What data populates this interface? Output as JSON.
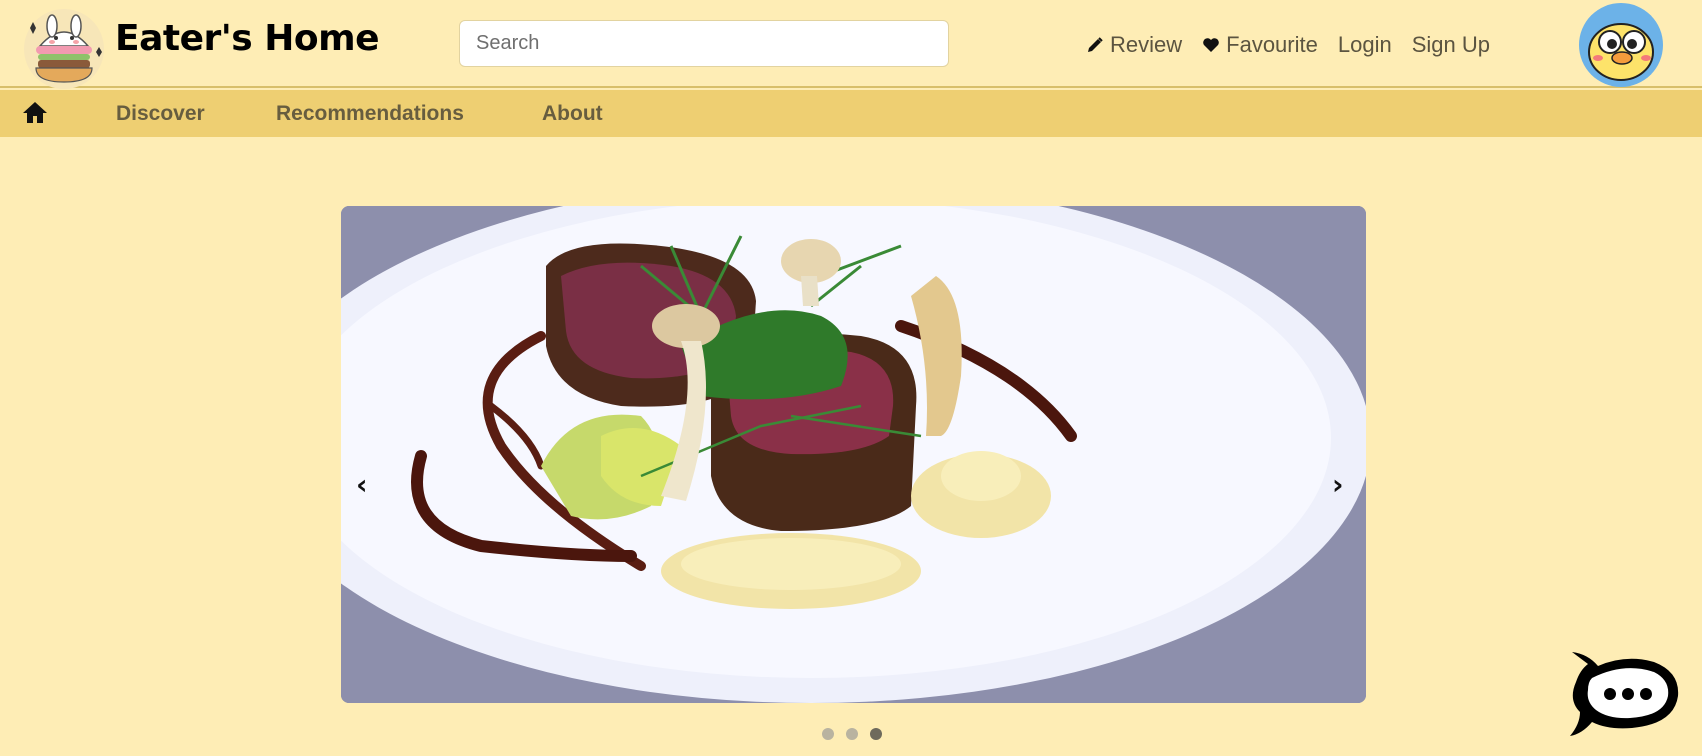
{
  "header": {
    "title": "Eater's Home",
    "search_placeholder": "Search",
    "links": [
      {
        "label": "Review",
        "icon": "pencil-icon"
      },
      {
        "label": "Favourite",
        "icon": "heart-icon"
      },
      {
        "label": "Login"
      },
      {
        "label": "Sign Up"
      }
    ]
  },
  "nav": {
    "home_icon": "home-icon",
    "items": [
      "Discover",
      "Recommendations",
      "About"
    ]
  },
  "carousel": {
    "prev": "‹",
    "next": "›",
    "slide_count": 3,
    "active_slide": 3
  },
  "colors": {
    "background": "#feedb5",
    "navbar": "#eecf72",
    "nav_text": "#675d3f"
  }
}
